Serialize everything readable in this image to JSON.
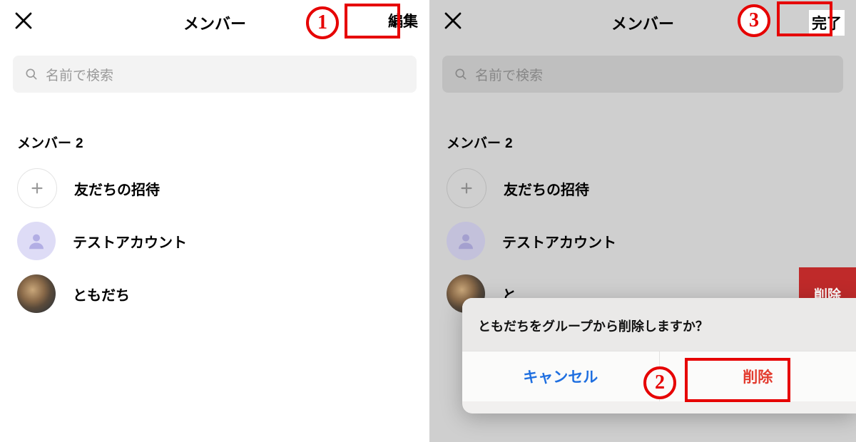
{
  "left": {
    "header": {
      "title": "メンバー",
      "action": "編集"
    },
    "search": {
      "placeholder": "名前で検索"
    },
    "section": {
      "label": "メンバー",
      "count": "2"
    },
    "rows": {
      "invite": "友だちの招待",
      "user1": "テストアカウント",
      "user2": "ともだち"
    }
  },
  "right": {
    "header": {
      "title": "メンバー",
      "action": "完了"
    },
    "search": {
      "placeholder": "名前で検索"
    },
    "section": {
      "label": "メンバー",
      "count": "2"
    },
    "rows": {
      "invite": "友だちの招待",
      "user1": "テストアカウント",
      "user2": "と",
      "delete_btn": "削除"
    },
    "modal": {
      "message": "ともだちをグループから削除しますか？",
      "cancel": "キャンセル",
      "delete": "削除"
    }
  },
  "annotations": {
    "n1": "1",
    "n2": "2",
    "n3": "3"
  }
}
